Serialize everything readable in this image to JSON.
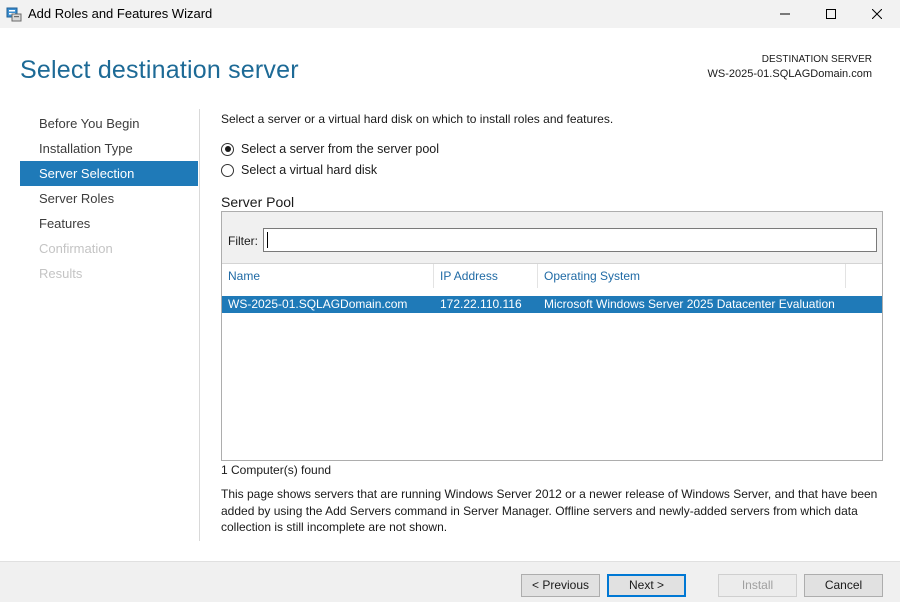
{
  "window": {
    "title": "Add Roles and Features Wizard",
    "controls": {
      "minimize": "minimize-icon",
      "maximize": "maximize-icon",
      "close": "close-icon"
    }
  },
  "header": {
    "title": "Select destination server",
    "destination_label": "DESTINATION SERVER",
    "destination_value": "WS-2025-01.SQLAGDomain.com"
  },
  "nav": {
    "items": [
      {
        "label": "Before You Begin",
        "state": "normal"
      },
      {
        "label": "Installation Type",
        "state": "normal"
      },
      {
        "label": "Server Selection",
        "state": "active"
      },
      {
        "label": "Server Roles",
        "state": "normal"
      },
      {
        "label": "Features",
        "state": "normal"
      },
      {
        "label": "Confirmation",
        "state": "disabled"
      },
      {
        "label": "Results",
        "state": "disabled"
      }
    ]
  },
  "main": {
    "intro": "Select a server or a virtual hard disk on which to install roles and features.",
    "options": [
      {
        "label": "Select a server from the server pool",
        "checked": true
      },
      {
        "label": "Select a virtual hard disk",
        "checked": false
      }
    ],
    "pool": {
      "title": "Server Pool",
      "filter_label": "Filter:",
      "filter_value": "",
      "columns": [
        "Name",
        "IP Address",
        "Operating System"
      ],
      "rows": [
        {
          "name": "WS-2025-01.SQLAGDomain.com",
          "ip": "172.22.110.116",
          "os": "Microsoft Windows Server 2025 Datacenter Evaluation",
          "selected": true
        }
      ]
    },
    "found": "1 Computer(s) found",
    "description": "This page shows servers that are running Windows Server 2012 or a newer release of Windows Server, and that have been added by using the Add Servers command in Server Manager. Offline servers and newly-added servers from which data collection is still incomplete are not shown."
  },
  "footer": {
    "previous": "< Previous",
    "next": "Next >",
    "install": "Install",
    "cancel": "Cancel"
  },
  "colors": {
    "accent": "#1f7ab8",
    "header_title": "#1d6a96",
    "column_header": "#1f6aa5",
    "disabled_text": "#c4c4c4"
  }
}
